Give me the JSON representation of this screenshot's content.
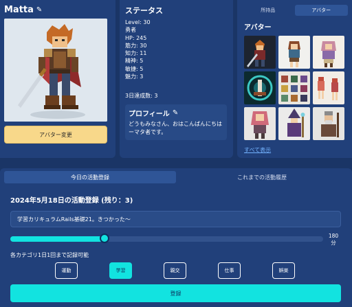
{
  "profile": {
    "name": "Matta",
    "change_avatar_label": "アバター変更"
  },
  "status": {
    "title": "ステータス",
    "lines": [
      "Level: 30",
      "勇者",
      "HP: 245",
      "筋力: 30",
      "知力: 11",
      "精神: 5",
      "敏捷: 5",
      "魅力: 3"
    ],
    "completed": "3日達成数: 3",
    "profile_title": "プロフィール",
    "profile_text": "どうもみなさん、おはこんばんにちはーマタ者です。"
  },
  "avatar_panel": {
    "tabs": [
      {
        "label": "所持品",
        "active": false
      },
      {
        "label": "アバター",
        "active": true
      }
    ],
    "heading": "アバター",
    "thumbnails": [
      {
        "name": "knight-sword",
        "bg": "#1d2430"
      },
      {
        "name": "adventurer-girl",
        "bg": "#f1f1ee"
      },
      {
        "name": "mage-girl",
        "bg": "#f3efe8"
      },
      {
        "name": "teal-emblem",
        "bg": "#0c2a2e"
      },
      {
        "name": "item-sheet",
        "bg": "#e9e6df"
      },
      {
        "name": "dancer-sprites",
        "bg": "#f2ede6"
      },
      {
        "name": "pink-hair-girl",
        "bg": "#e8e6e3"
      },
      {
        "name": "wizard",
        "bg": "#ecebea"
      },
      {
        "name": "elder",
        "bg": "#e6e5e2"
      }
    ],
    "show_all": "すべて表示"
  },
  "activity": {
    "tabs": [
      {
        "label": "今日の活動登録",
        "active": true
      },
      {
        "label": "これまでの活動履歴",
        "active": false
      }
    ],
    "title": "2024年5月18日の活動登録 (残り：3)",
    "input_value": "学習カリキュラムRails基礎21。きつかった〜",
    "slider": {
      "value": 180,
      "unit": "分",
      "fraction": 0.3
    },
    "note": "各カテゴリ1日1回まで記録可能",
    "categories": [
      {
        "label": "運動",
        "active": false
      },
      {
        "label": "学習",
        "active": true
      },
      {
        "label": "親交",
        "active": false
      },
      {
        "label": "仕事",
        "active": false
      },
      {
        "label": "娯楽",
        "active": false
      }
    ],
    "submit_label": "登録"
  },
  "colors": {
    "accent": "#12e3e0",
    "button_yellow": "#f8d88a",
    "background": "#1a3566",
    "panel": "#21407a"
  }
}
